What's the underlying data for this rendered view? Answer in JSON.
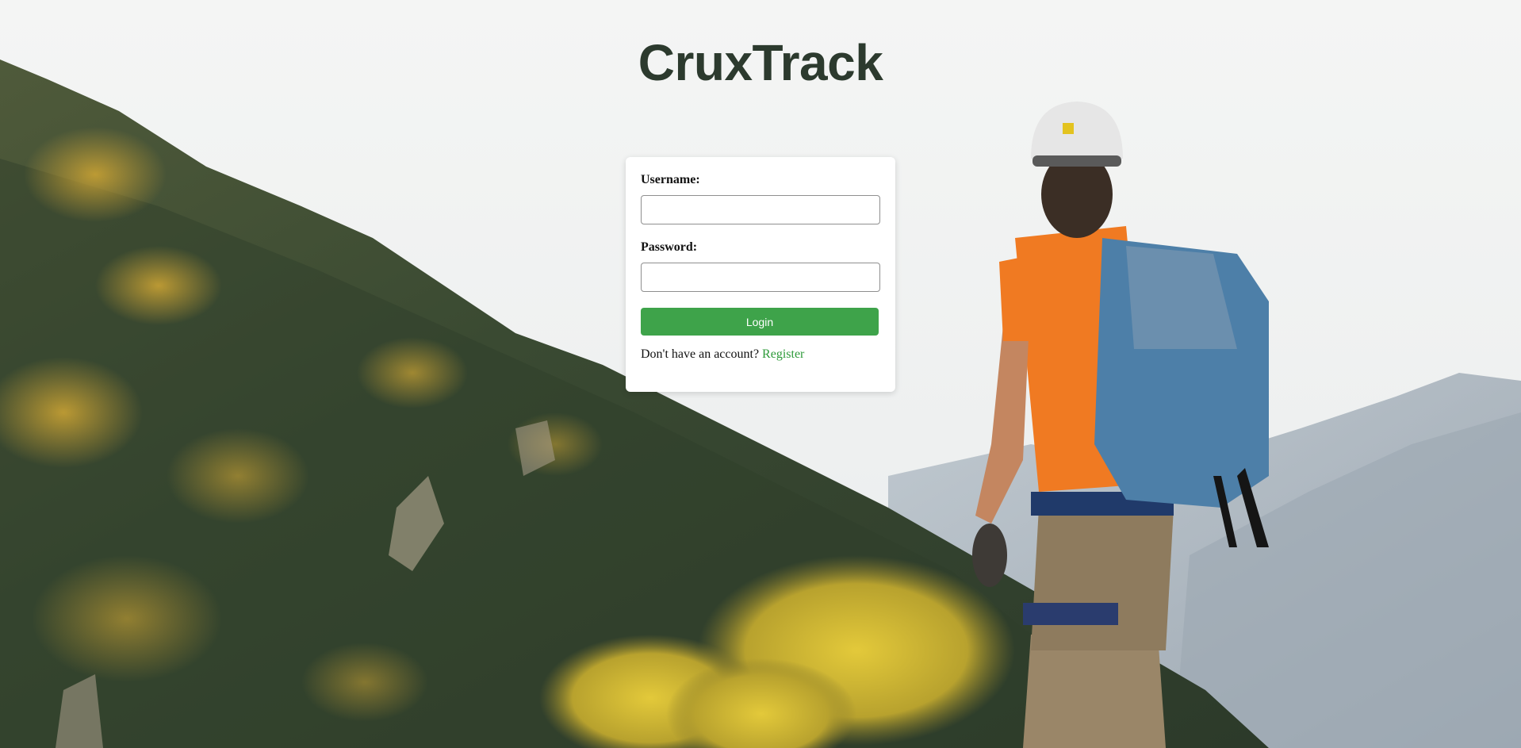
{
  "app": {
    "title": "CruxTrack"
  },
  "login_form": {
    "username_label": "Username:",
    "username_value": "",
    "password_label": "Password:",
    "password_value": "",
    "login_button_label": "Login",
    "register_prompt": "Don't have an account?",
    "register_link_label": "Register"
  },
  "colors": {
    "title": "#2c3a2e",
    "button": "#3ea34a",
    "link": "#2e9a3a"
  }
}
